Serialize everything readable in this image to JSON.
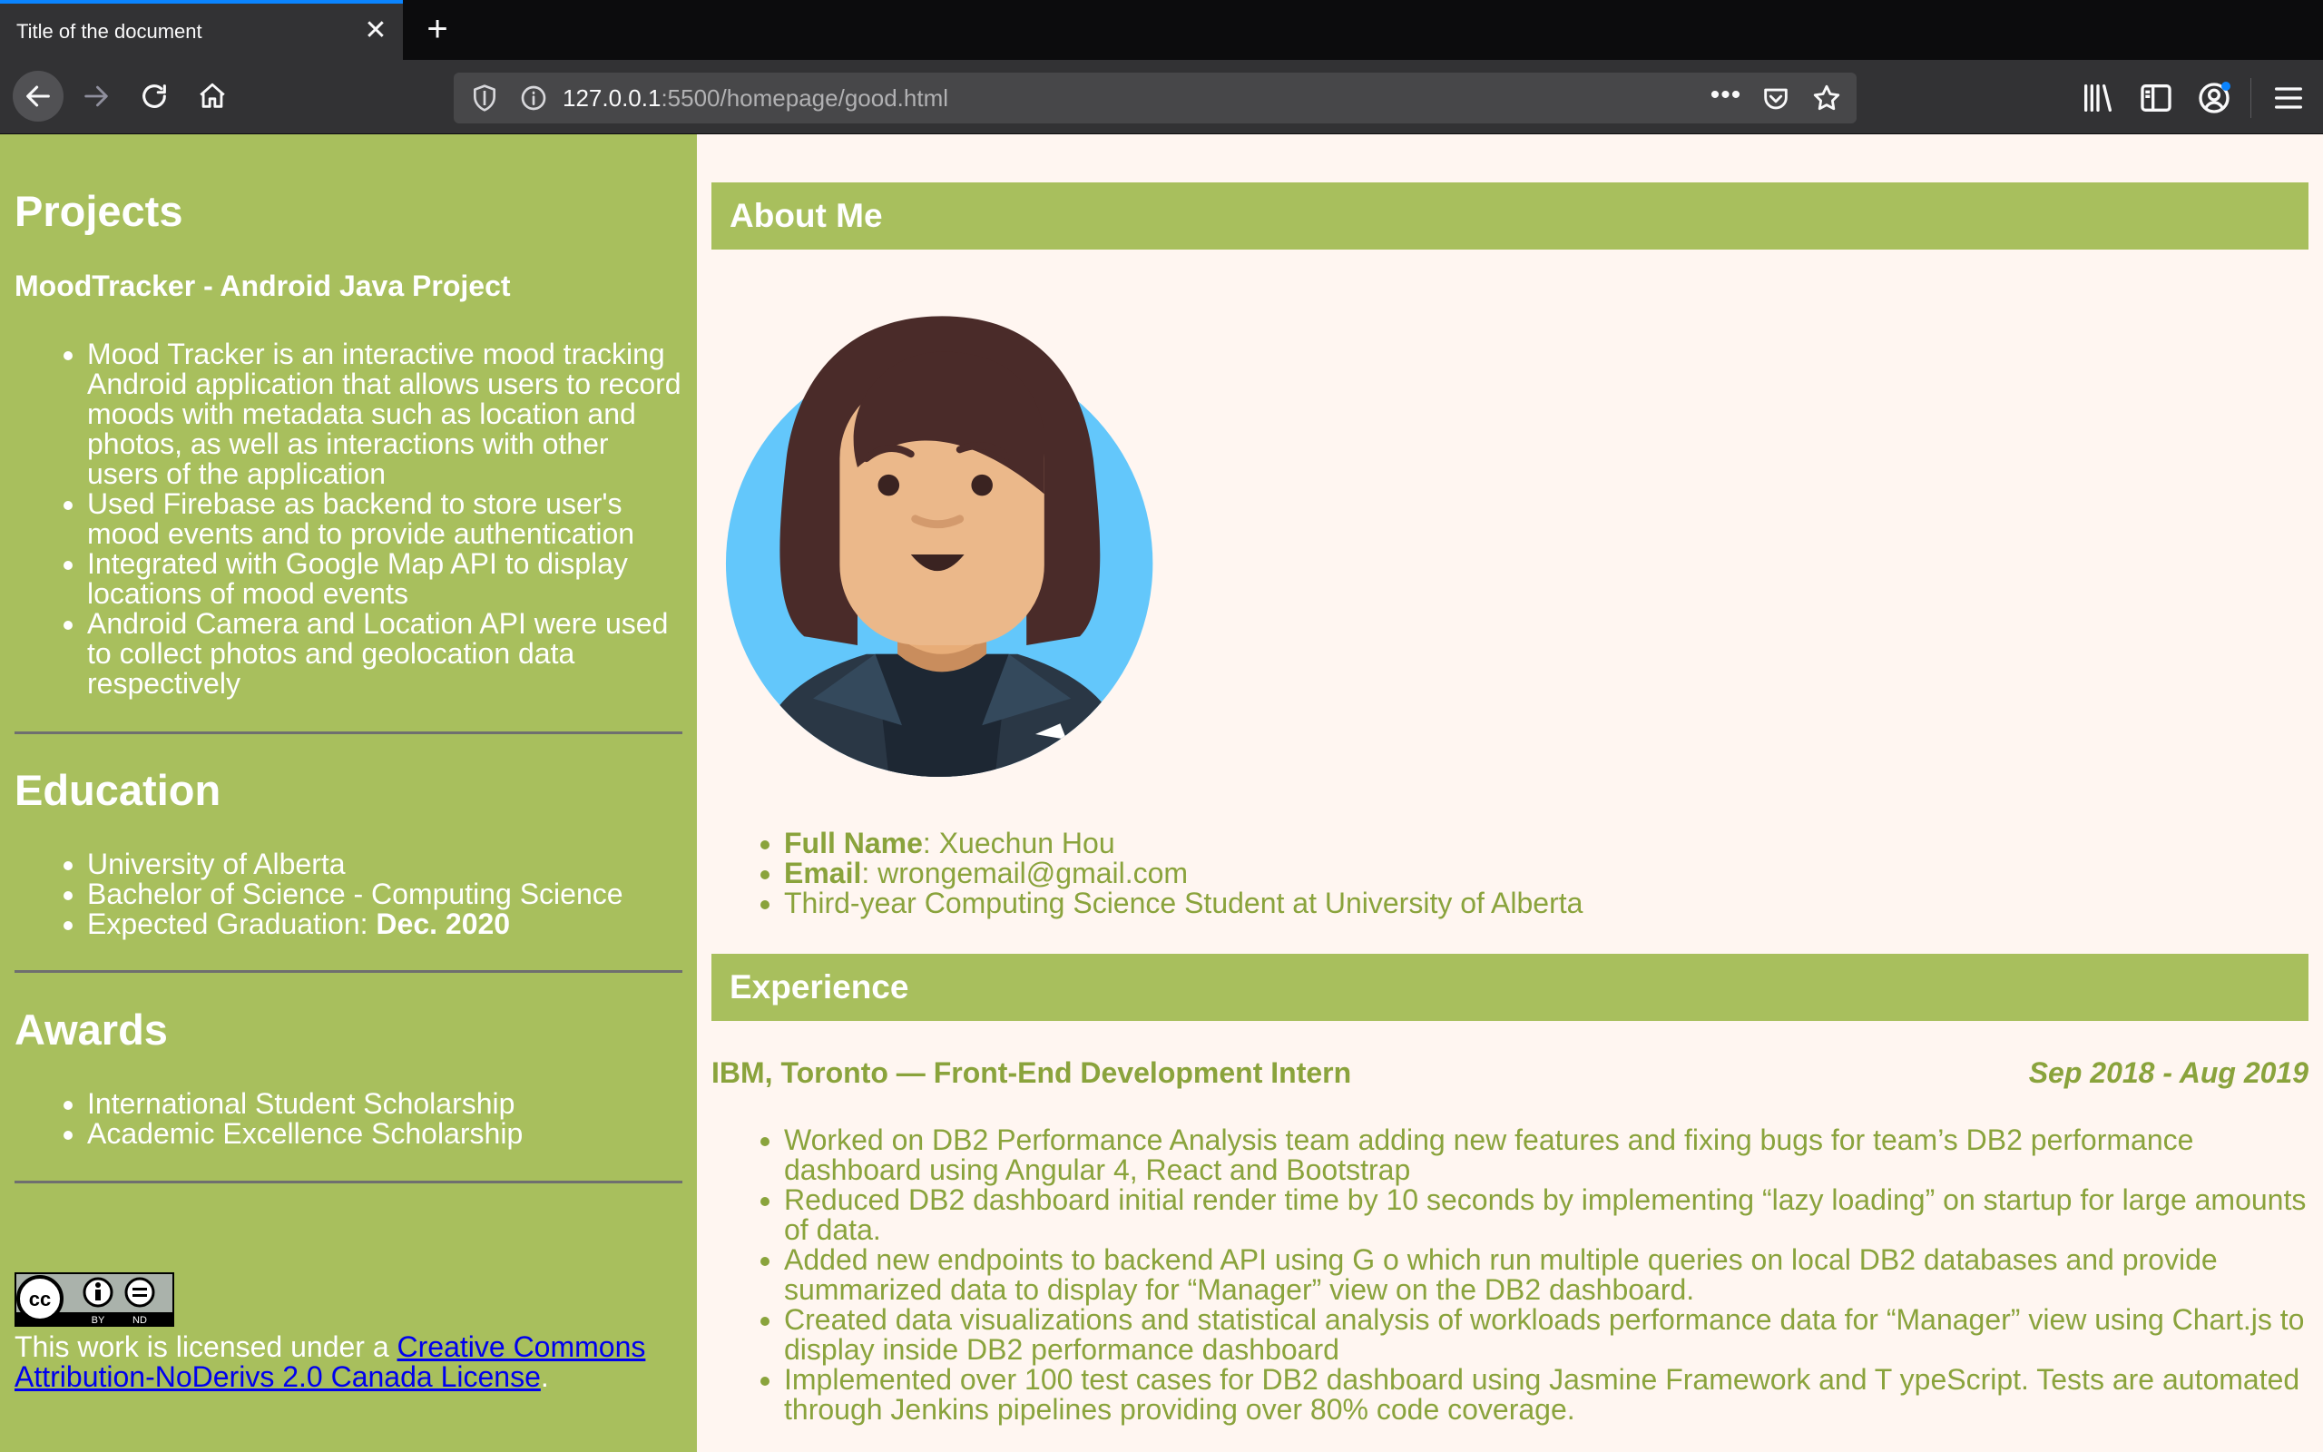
{
  "browser": {
    "tab_title": "Title of the document",
    "url_host": "127.0.0.1",
    "url_path": ":5500/homepage/good.html"
  },
  "left": {
    "projects": {
      "heading": "Projects",
      "project_title": "MoodTracker - Android Java Project",
      "items": [
        "Mood Tracker is an interactive mood tracking Android application that allows users to record moods with metadata such as location and photos, as well as interactions with other users of the application",
        "Used Firebase as backend to store user's mood events and to provide authentication",
        "Integrated with Google Map API to display locations of mood events",
        "Android Camera and Location API were used to collect photos and geolocation data respectively"
      ]
    },
    "education": {
      "heading": "Education",
      "items": [
        "University of Alberta",
        "Bachelor of Science - Computing Science"
      ],
      "graduation_label": "Expected Graduation: ",
      "graduation_value": "Dec. 2020"
    },
    "awards": {
      "heading": "Awards",
      "items": [
        "International Student Scholarship",
        "Academic Excellence Scholarship"
      ]
    },
    "license": {
      "badge_cc": "cc",
      "badge_by": "BY",
      "badge_nd": "ND",
      "text_prefix": "This work is licensed under a ",
      "link_text": "Creative Commons Attribution-NoDerivs 2.0 Canada License",
      "text_suffix": "."
    }
  },
  "right": {
    "about": {
      "heading": "About Me",
      "full_name_label": "Full Name",
      "full_name_value": ": Xuechun Hou",
      "email_label": "Email",
      "email_value": ": wrongemail@gmail.com",
      "student_line": "Third-year Computing Science Student at University of Alberta"
    },
    "experience": {
      "heading": "Experience",
      "job_title": "IBM, Toronto — Front-End Development Intern",
      "job_dates": "Sep 2018 - Aug 2019",
      "items": [
        "Worked on DB2 Performance Analysis team adding new features and fixing bugs for team’s DB2 performance dashboard using Angular 4, React and Bootstrap",
        "Reduced DB2 dashboard initial render time by 10 seconds by implementing “lazy loading” on startup for large amounts of data.",
        "Added new endpoints to backend API using G o which run multiple queries on local DB2 databases and provide summarized data to display for “Manager” view on the DB2 dashboard.",
        "Created data visualizations and statistical analysis of workloads performance data for “Manager” view using Chart.js to display inside DB2 performance dashboard",
        "Implemented over 100 test cases for DB2 dashboard using Jasmine Framework and T ypeScript. Tests are automated through Jenkins pipelines providing over 80% code coverage."
      ]
    }
  }
}
